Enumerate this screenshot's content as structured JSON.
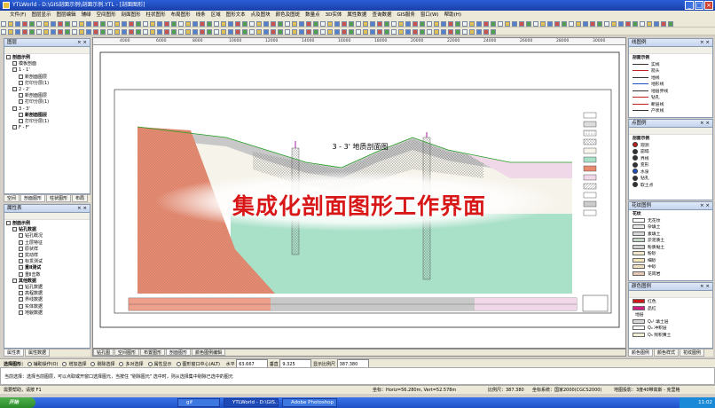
{
  "window": {
    "title": "YTLWorld - D:\\GIS剖面示例\\剖面示例.YTL - [剖面图形]",
    "controls": [
      "_",
      "□",
      "×"
    ]
  },
  "menu": [
    "文件(F)",
    "图层显示",
    "图层编辑",
    "辅绿",
    "空间图形",
    "剖面图形",
    "柱状图形",
    "布局图形",
    "线条",
    "区域",
    "图形文本",
    "点及图块",
    "颜色及图斑",
    "数量点",
    "3D实体",
    "属性数据",
    "查询数据",
    "GIS服务",
    "窗口(W)",
    "帮助(H)"
  ],
  "layers_panel": {
    "title": "图层",
    "close": "× ×",
    "items": [
      {
        "label": "剖面示例",
        "indent": 0,
        "bold": true
      },
      {
        "label": "模板剖面",
        "indent": 1,
        "bold": false
      },
      {
        "label": "1 - 1'",
        "indent": 1,
        "bold": false
      },
      {
        "label": "新剖面图层",
        "indent": 2,
        "bold": false
      },
      {
        "label": "打印分层(1)",
        "indent": 2,
        "bold": false
      },
      {
        "label": "2 - 2'",
        "indent": 1,
        "bold": false
      },
      {
        "label": "新剖面图层",
        "indent": 2,
        "bold": false
      },
      {
        "label": "打印分层(1)",
        "indent": 2,
        "bold": false
      },
      {
        "label": "3 - 3'",
        "indent": 1,
        "bold": false
      },
      {
        "label": "新剖面图层",
        "indent": 2,
        "bold": true
      },
      {
        "label": "打印分层(1)",
        "indent": 2,
        "bold": false
      },
      {
        "label": "F - F'",
        "indent": 1,
        "bold": false
      }
    ],
    "tabs": [
      "空间",
      "剖面图形",
      "柱状图形",
      "布局"
    ]
  },
  "properties_panel": {
    "title": "属性表",
    "close": "× ×",
    "items": [
      {
        "label": "剖面示例",
        "indent": 0,
        "bold": true
      },
      {
        "label": "钻孔数据",
        "indent": 1,
        "bold": true
      },
      {
        "label": "钻孔概况",
        "indent": 2,
        "bold": false
      },
      {
        "label": "土层特征",
        "indent": 2,
        "bold": false
      },
      {
        "label": "原状样",
        "indent": 2,
        "bold": false
      },
      {
        "label": "扰动样",
        "indent": 2,
        "bold": false
      },
      {
        "label": "标贯测试",
        "indent": 2,
        "bold": false
      },
      {
        "label": "重Ⅱ测试",
        "indent": 2,
        "bold": true
      },
      {
        "label": "重Ⅱ击数",
        "indent": 2,
        "bold": false
      },
      {
        "label": "其他数据",
        "indent": 1,
        "bold": true
      },
      {
        "label": "钻孔数据",
        "indent": 2,
        "bold": false
      },
      {
        "label": "高程数据",
        "indent": 2,
        "bold": false
      },
      {
        "label": "界线数据",
        "indent": 2,
        "bold": false
      },
      {
        "label": "实体数据",
        "indent": 2,
        "bold": false
      },
      {
        "label": "地貌数据",
        "indent": 2,
        "bold": false
      }
    ],
    "tabs": [
      "属性表",
      "属性数据"
    ]
  },
  "drawing": {
    "sheet_title": "3 - 3'  地质剖面图",
    "overlay_text": "集成化剖面图形工作界面",
    "ruler_marks": [
      "4000",
      "6000",
      "8000",
      "10000",
      "12000",
      "14000",
      "16000",
      "18000",
      "20000",
      "22000",
      "24000",
      "26000",
      "28000",
      "30000"
    ],
    "bottom_tabs": [
      "钻孔图",
      "空间图形",
      "布置图形",
      "剖面图形",
      "颜色图例编辑"
    ]
  },
  "line_legend": {
    "title": "线图例",
    "close": "× ×",
    "group": "剖面示例",
    "items": [
      {
        "label": "实线",
        "color": "#333333"
      },
      {
        "label": "箭头",
        "color": "#c02020"
      },
      {
        "label": "地线",
        "color": "#333333"
      },
      {
        "label": "地形线",
        "color": "#2050c0"
      },
      {
        "label": "地层界线",
        "color": "#333333"
      },
      {
        "label": "钻孔",
        "color": "#c02020"
      },
      {
        "label": "断层线",
        "color": "#c02020"
      },
      {
        "label": "产状线",
        "color": "#333333"
      }
    ]
  },
  "point_legend": {
    "title": "点图例",
    "close": "× ×",
    "group": "剖面示例",
    "items": [
      {
        "label": "观测",
        "color": "#c02020"
      },
      {
        "label": "崩塌",
        "color": "#333333"
      },
      {
        "label": "界线",
        "color": "#333333"
      },
      {
        "label": "变形",
        "color": "#333333"
      },
      {
        "label": "水泉",
        "color": "#2050c0"
      },
      {
        "label": "钻孔",
        "color": "#333333"
      },
      {
        "label": "取土点",
        "color": "#333333"
      }
    ]
  },
  "fill_legend": {
    "title": "花纹图例",
    "close": "× ×",
    "group": "花纹",
    "items": [
      {
        "label": "无花纹",
        "pattern": "#ffffff"
      },
      {
        "label": "杂填土",
        "pattern": "#e8e8e8"
      },
      {
        "label": "素填土",
        "pattern": "#d8d8d8"
      },
      {
        "label": "淤泥质土",
        "pattern": "#c8d8c8"
      },
      {
        "label": "粉质黏土",
        "pattern": "#d0d0d0"
      },
      {
        "label": "粉砂",
        "pattern": "#f0e8c8"
      },
      {
        "label": "细砂",
        "pattern": "#f4e4b8"
      },
      {
        "label": "中砂",
        "pattern": "#ece0c0"
      },
      {
        "label": "花岗岩",
        "pattern": "#e8c8b8"
      }
    ]
  },
  "color_legend": {
    "title": "颜色图例",
    "close": "× ×",
    "items": [
      {
        "label": "红色",
        "color": "#d01818"
      },
      {
        "label": "品红",
        "color": "#d02080"
      },
      {
        "label": "地层",
        "color": null
      },
      {
        "label": "Q₄¹ 填土层",
        "color": "#d8d8d8"
      },
      {
        "label": "Q₄ 冲积层",
        "color": "#ffffff"
      },
      {
        "label": "Q₃ 残积黄土",
        "color": "#f4f0d8"
      }
    ],
    "tabs": [
      "颜色图例",
      "颜色样式",
      "花纹图例"
    ]
  },
  "status": {
    "selection_mode": "选择图形：",
    "options": [
      "辅助操作(O)",
      "增加选择",
      "剔除选择",
      "多对选择",
      "属性显示",
      "图形窗口中心(ALT)"
    ],
    "horiz_label": "水平",
    "horiz_value": "63.667",
    "vert_label": "垂直",
    "vert_value": "9.325",
    "scale_label": "显示比例尺",
    "scale_value": "387.380",
    "hint": "当前选择：选择当前图层，可以点取或开窗口选择图元，当按住 \"剔除图元\" 选中时，则从选择集中剔除已选中的图元",
    "help": "需要帮助，请按 F1",
    "coords": "坐标：Horiz=56.280m, Vert=52.578m",
    "ratio": "比例尺：387.380",
    "system": "坐标系统：国家2000(CGCS2000)",
    "extra": "地图投影：3度40带高斯 - 克里格"
  },
  "taskbar": {
    "start": "开始",
    "tasks": [
      "gif",
      "YTLWorld - D:\\GIS...",
      "Adobe Photoshop"
    ],
    "clock": "11:02"
  }
}
